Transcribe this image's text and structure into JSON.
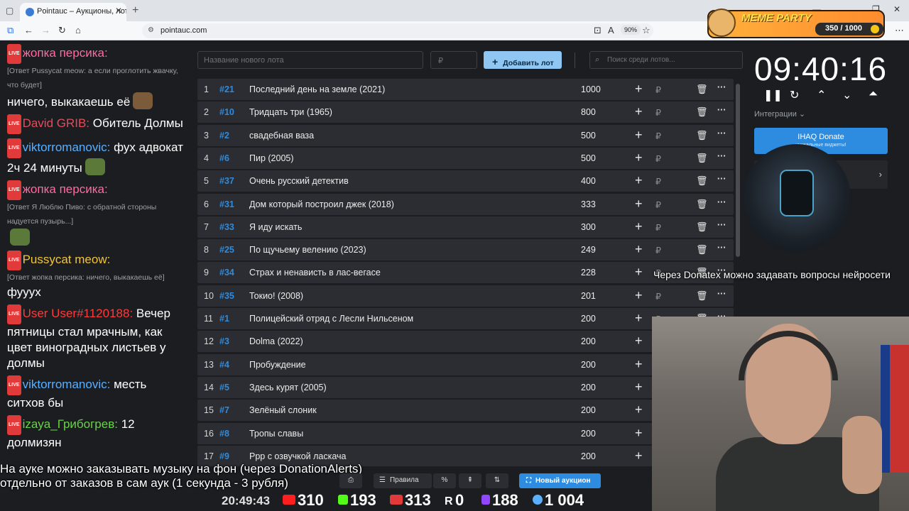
{
  "browser": {
    "tab_title": "Pointauc – Аукционы, лотере",
    "url": "pointauc.com",
    "zoom": "90%"
  },
  "meme_party": {
    "title": "MEME PARTY",
    "score": "350 / 1000"
  },
  "chat": {
    "messages": [
      {
        "user": "жопка персика:",
        "user_color": "#ff6b9d",
        "reply": "[Ответ Pussycat meow: а если проглотить жвачку, что будет]",
        "text": "ничего, выкакаешь её"
      },
      {
        "user": "David GRIB:",
        "user_color": "#e84a5a",
        "text": "Обитель Долмы"
      },
      {
        "user": "viktorromanovic:",
        "user_color": "#5ab0ff",
        "text": "фух адвокат 2ч 24 минуты"
      },
      {
        "user": "жопка персика:",
        "user_color": "#ff6b9d",
        "reply": "[Ответ Я Люблю Пиво: с обратной стороны надуется пузырь...]",
        "text": ""
      },
      {
        "user": "Pussycat meow:",
        "user_color": "#f0c43c",
        "reply": "[Ответ жопка персика: ничего, выкакаешь её]",
        "text": "фууух"
      },
      {
        "user": "User User#1120188:",
        "user_color": "#ff3a3a",
        "text": "Вечер пятницы стал мрачным, как цвет виноградных листьев у долмы"
      },
      {
        "user": "viktorromanovic:",
        "user_color": "#5ab0ff",
        "text": "месть ситхов бы"
      },
      {
        "user": "izaya_Грибогрев:",
        "user_color": "#6ad14a",
        "text": "12 долмизян"
      }
    ]
  },
  "toolbar": {
    "lot_placeholder": "Название нового лота",
    "amount_placeholder": "₽",
    "add_label": "Добавить лот",
    "search_placeholder": "Поиск среди лотов..."
  },
  "lots": [
    {
      "n": "1",
      "id": "#21",
      "name": "Последний день на земле (2021)",
      "amount": "1000"
    },
    {
      "n": "2",
      "id": "#10",
      "name": "Тридцать три (1965)",
      "amount": "800"
    },
    {
      "n": "3",
      "id": "#2",
      "name": "свадебная ваза",
      "amount": "500"
    },
    {
      "n": "4",
      "id": "#6",
      "name": "Пир (2005)",
      "amount": "500"
    },
    {
      "n": "5",
      "id": "#37",
      "name": "Очень русский детектив",
      "amount": "400"
    },
    {
      "n": "6",
      "id": "#31",
      "name": "Дом который построил джек (2018)",
      "amount": "333"
    },
    {
      "n": "7",
      "id": "#33",
      "name": "Я иду искать",
      "amount": "300"
    },
    {
      "n": "8",
      "id": "#25",
      "name": "По щучьему велению (2023)",
      "amount": "249"
    },
    {
      "n": "9",
      "id": "#34",
      "name": "Страх и ненависть в лас-вегасе",
      "amount": "228"
    },
    {
      "n": "10",
      "id": "#35",
      "name": "Токио! (2008)",
      "amount": "201"
    },
    {
      "n": "11",
      "id": "#1",
      "name": "Полицейский отряд с Лесли Нильсеном",
      "amount": "200"
    },
    {
      "n": "12",
      "id": "#3",
      "name": " Dolma (2022)",
      "amount": "200"
    },
    {
      "n": "13",
      "id": "#4",
      "name": "Пробуждение",
      "amount": "200"
    },
    {
      "n": "14",
      "id": "#5",
      "name": "Здесь курят (2005)",
      "amount": "200"
    },
    {
      "n": "15",
      "id": "#7",
      "name": "Зелёный слоник",
      "amount": "200"
    },
    {
      "n": "16",
      "id": "#8",
      "name": "Тропы славы",
      "amount": "200"
    },
    {
      "n": "17",
      "id": "#9",
      "name": "Ррр с озвучкой ласкача",
      "amount": "200"
    }
  ],
  "row_icons": {
    "plus": "+",
    "rub": "₽",
    "delete": "🗑",
    "more": "···"
  },
  "timer": {
    "value": "09:40:16",
    "integrations_label": "Интеграции"
  },
  "donate_card": {
    "title": "IHAQ Donate",
    "subtitle": "уникальные виджеты!"
  },
  "overlays": {
    "question": "Через Donatex можно задавать вопросы нейросети",
    "bottom_line1": "На ауке можно заказывать музыку на фон (через DonationAlerts)",
    "bottom_line2": "отдельно от заказов в сам аук (1 секунда - 3 рубля)"
  },
  "bottom_controls": {
    "rules_label": "Правила",
    "percent_label": "%",
    "new_auction_label": "Новый аукцион"
  },
  "stats": {
    "time": "20:49:43",
    "youtube": "310",
    "kick": "193",
    "vk_live": "313",
    "rutube": "0",
    "twitch": "188",
    "viewers": "1 004"
  },
  "colors": {
    "accent": "#2d8ce0",
    "add_button": "#8fc6f2",
    "row_bg": "#2c2d32",
    "page_bg": "#1c1d21",
    "live_badge": "#e03a3a"
  }
}
